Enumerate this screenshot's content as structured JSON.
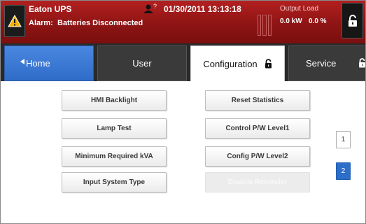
{
  "header": {
    "ups_title": "Eaton UPS",
    "alarm_label": "Alarm:",
    "alarm_text": "Batteries Disconnected",
    "datetime": "01/30/2011 13:13:18",
    "user_icon_label": "?",
    "output_title": "Output Load",
    "output_kw": "0.0 kW",
    "output_percent": "0.0 %",
    "icons": {
      "warning": "warning-icon",
      "user": "user-help-icon",
      "lock": "lock-icon"
    },
    "colors": {
      "bar": "#8e1414",
      "warning": "#f6b400"
    }
  },
  "tabs": {
    "home": "Home",
    "user": "User",
    "configuration": "Configuration",
    "service": "Service",
    "active": "configuration",
    "colors": {
      "home": "#2f6cc8"
    }
  },
  "buttons": {
    "hmi_backlight": "HMI Backlight",
    "lamp_test": "Lamp Test",
    "minimum_required_kva": "Minimum Required kVA",
    "input_system_type": "Input System Type",
    "reset_statistics": "Reset Statistics",
    "control_pw_level1": "Control P/W Level1",
    "config_pw_level2": "Config P/W Level2",
    "disable_reminder": "Disable Reminder"
  },
  "pagination": {
    "pages": [
      "1",
      "2"
    ],
    "current_page": "2",
    "colors": {
      "active": "#2c6ec9"
    }
  }
}
